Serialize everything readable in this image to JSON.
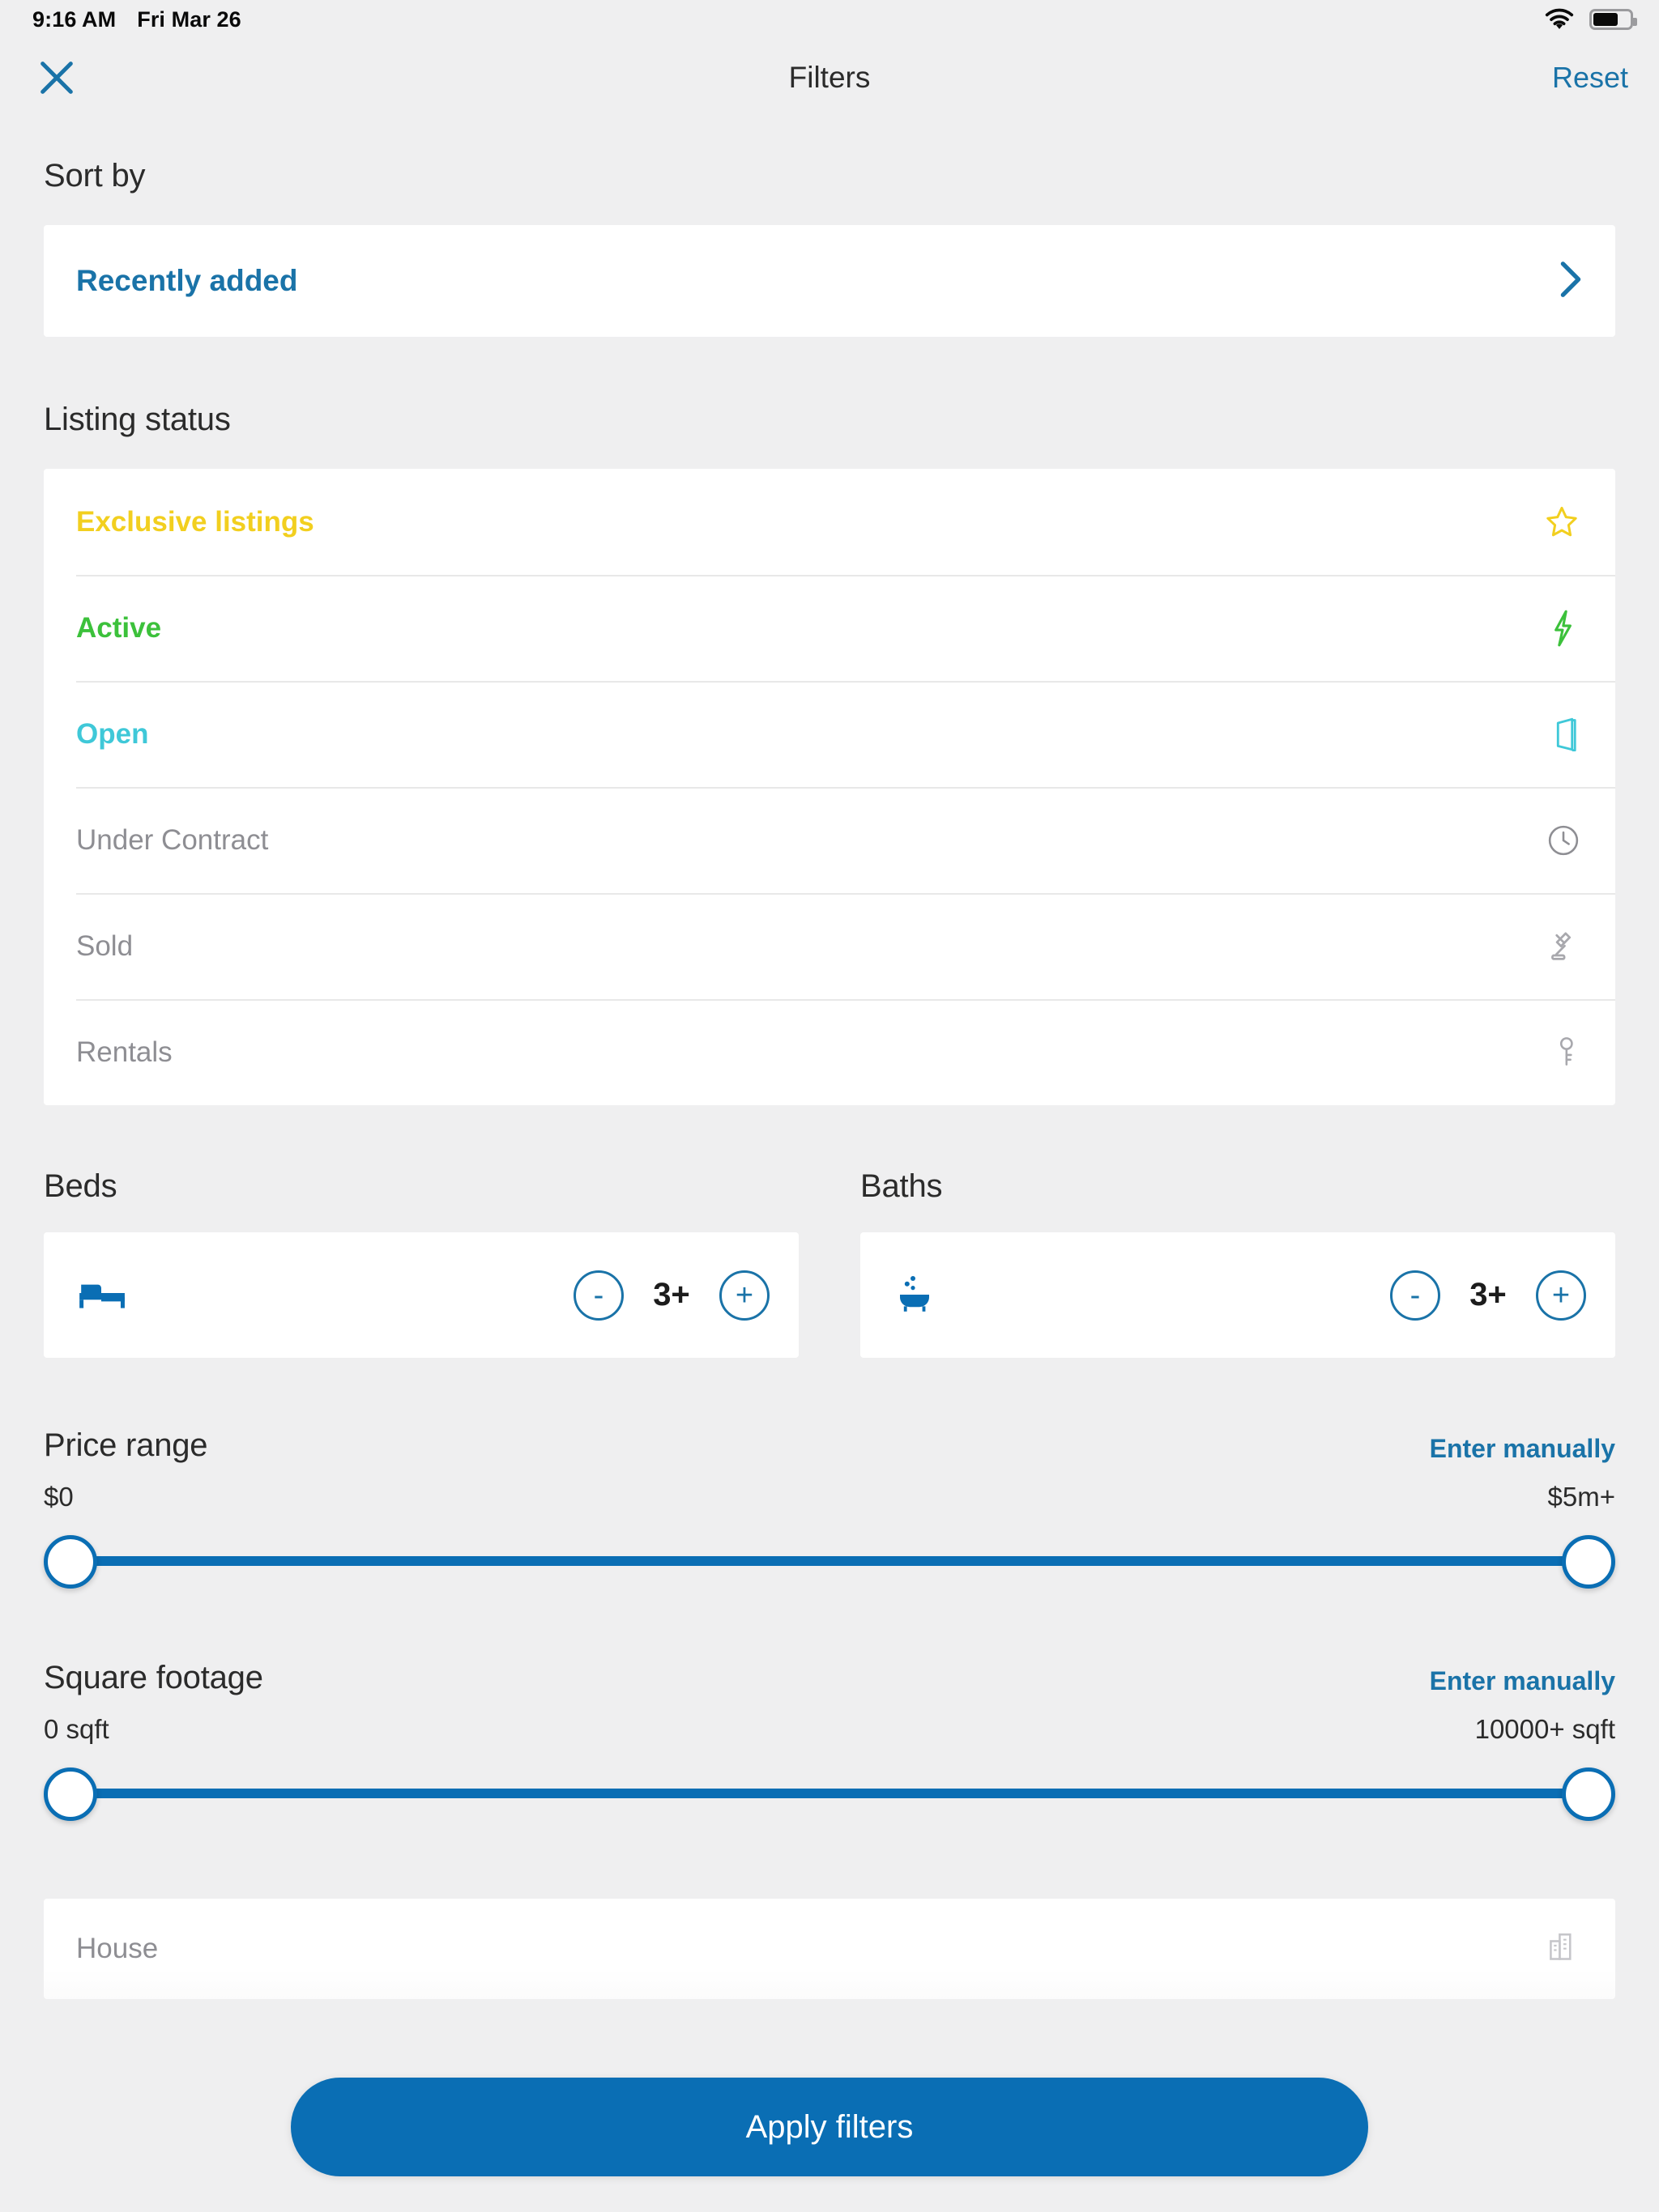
{
  "status_bar": {
    "time": "9:16 AM",
    "date": "Fri Mar 26",
    "wifi_icon": "wifi-icon",
    "battery_icon": "battery-icon",
    "battery_level_pct": 62
  },
  "nav": {
    "close_icon": "close-icon",
    "title": "Filters",
    "reset_label": "Reset"
  },
  "sort": {
    "heading": "Sort by",
    "selected": "Recently added",
    "chevron_icon": "chevron-right-icon"
  },
  "listing_status": {
    "heading": "Listing status",
    "rows": [
      {
        "label": "Exclusive listings",
        "icon": "star-icon",
        "color": "#F2CF1F",
        "selected": true
      },
      {
        "label": "Active",
        "icon": "lightning-icon",
        "color": "#3CC13B",
        "selected": true
      },
      {
        "label": "Open",
        "icon": "open-door-icon",
        "color": "#3FC8D8",
        "selected": true
      },
      {
        "label": "Under Contract",
        "icon": "clock-icon",
        "color": "#8E8E93",
        "selected": false
      },
      {
        "label": "Sold",
        "icon": "gavel-icon",
        "color": "#8E8E93",
        "selected": false
      },
      {
        "label": "Rentals",
        "icon": "key-icon",
        "color": "#8E8E93",
        "selected": false
      }
    ]
  },
  "beds": {
    "heading": "Beds",
    "icon": "bed-icon",
    "value": "3+",
    "decrement_label": "-",
    "increment_label": "+"
  },
  "baths": {
    "heading": "Baths",
    "icon": "bathtub-icon",
    "value": "3+",
    "decrement_label": "-",
    "increment_label": "+"
  },
  "price_range": {
    "heading": "Price range",
    "manual_label": "Enter manually",
    "min_label": "$0",
    "max_label": "$5m+"
  },
  "square_footage": {
    "heading": "Square footage",
    "manual_label": "Enter manually",
    "min_label": "0 sqft",
    "max_label": "10000+ sqft"
  },
  "property_type": {
    "rows": [
      {
        "label": "House",
        "icon": "building-icon"
      }
    ]
  },
  "apply": {
    "label": "Apply filters"
  },
  "colors": {
    "accent_blue": "#0a6eb4",
    "link_blue": "#1a73a8",
    "page_bg": "#efeff0",
    "card_bg": "#ffffff",
    "muted_text": "#8e8e93"
  }
}
